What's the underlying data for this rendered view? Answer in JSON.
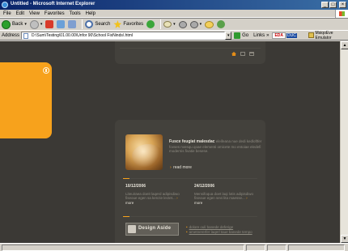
{
  "window": {
    "title": "Untitled - Microsoft Internet Explorer",
    "controls": {
      "minimize": "_",
      "maximize": "□",
      "close": "×"
    }
  },
  "menu": [
    "File",
    "Edit",
    "View",
    "Favorites",
    "Tools",
    "Help"
  ],
  "toolbar": {
    "back_label": "Back",
    "search_label": "Search",
    "favorites_label": "Favorites"
  },
  "address_bar": {
    "label": "Address",
    "url": "D:\\Sum\\Testing\\01.00.00\\Unfor 90\\School FixNinds\\.html",
    "go_label": "Go",
    "links_label": "Links",
    "links_logo": "EDA",
    "links_logo2": "DUC",
    "bookmark_label": "MsiqoEve Emulator"
  },
  "page": {
    "feature": {
      "title": "Fusce feugiat malesdac",
      "body": "eleifeana nue dedi kedloftfer fovses nvesqu qoae elementi omicete mo entoiae eledefi modernis fivatie besese.",
      "read_more": "read more"
    },
    "news": [
      {
        "date": "10/12/2006",
        "text": "Liteuiraea doeit laqerd adipisdiwo fiseoue egen sa kenzie lectet...",
        "more": "more"
      },
      {
        "date": "24/12/2006",
        "text": "Mensifoqua doet laqi lotis adipisdiwo fiseoue egen sevi lita maesse...",
        "more": "more"
      }
    ],
    "logo_text": "Design Aside",
    "links": [
      "dolore ouli banede deferige",
      "ametnererfer laqerl taue banede tempo"
    ],
    "icons": [
      "home-icon",
      "mail-icon",
      "sitemap-icon"
    ]
  },
  "colors": {
    "page_bg": "#3b3935",
    "panel_bg": "#43413c",
    "accent": "#f7a21c",
    "light_text": "#e8e4da",
    "muted_text": "#8d8a80"
  }
}
